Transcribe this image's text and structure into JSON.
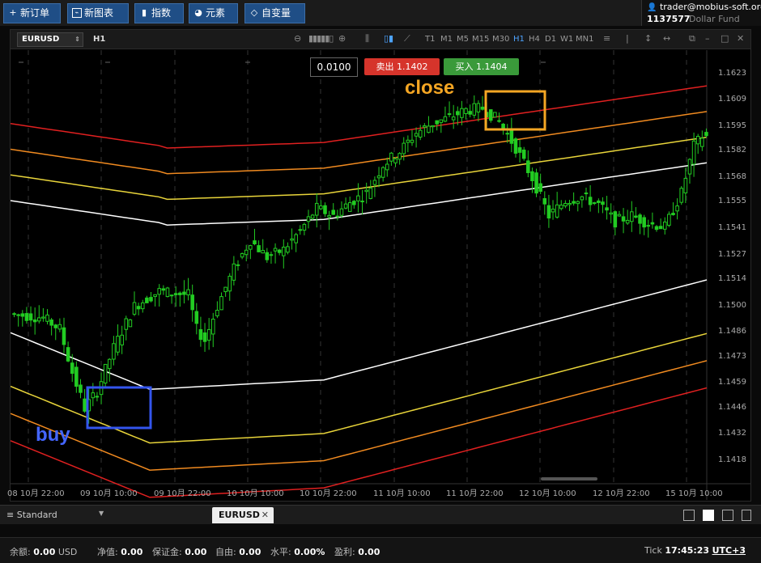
{
  "toolbar": {
    "buttons": [
      {
        "label": "新订单",
        "icon": "plus-icon"
      },
      {
        "label": "新图表",
        "icon": "chart-icon"
      },
      {
        "label": "指数",
        "icon": "indicator-icon"
      },
      {
        "label": "元素",
        "icon": "element-icon"
      },
      {
        "label": "自变量",
        "icon": "variable-icon"
      }
    ]
  },
  "account": {
    "email": "trader@mobius-soft.org",
    "number": "1137577",
    "name": "Dollar Fund"
  },
  "chart_header": {
    "symbol": "EURUSD",
    "timeframe": "H1",
    "timeframes": [
      "T1",
      "M1",
      "M5",
      "M15",
      "M30",
      "H1",
      "H4",
      "D1",
      "W1",
      "MN1"
    ],
    "active_timeframe": "H1"
  },
  "trade": {
    "lots": "0.0100",
    "sell_label": "卖出",
    "sell_price": "1.1402",
    "buy_label": "买入",
    "buy_price": "1.1404",
    "sell_color": "#d6342b",
    "buy_color": "#3a9a3a"
  },
  "annotations": {
    "close": "close",
    "buy": "buy"
  },
  "chart_data": {
    "type": "candlestick",
    "symbol": "EURUSD",
    "timeframe": "H1",
    "price_axis_ticks": [
      "1.1623",
      "1.1609",
      "1.1595",
      "1.1582",
      "1.1568",
      "1.1555",
      "1.1541",
      "1.1527",
      "1.1514",
      "1.1500",
      "1.1486",
      "1.1473",
      "1.1459",
      "1.1446",
      "1.1432",
      "1.1418"
    ],
    "time_axis_ticks": [
      "08 10月 22:00",
      "09 10月 10:00",
      "09 10月 22:00",
      "10 10月 10:00",
      "10 10月 22:00",
      "11 10月 10:00",
      "11 10月 22:00",
      "12 10月 10:00",
      "12 10月 22:00",
      "15 10月 10:00"
    ],
    "ylim": [
      1.1406,
      1.1634
    ],
    "bands": [
      {
        "name": "upper-2",
        "color": "#e02020"
      },
      {
        "name": "upper-1",
        "color": "#f08a20"
      },
      {
        "name": "upper-0",
        "color": "#e8d43a"
      },
      {
        "name": "middle",
        "color": "#ffffff"
      },
      {
        "name": "lower-0",
        "color": "#e8d43a"
      },
      {
        "name": "lower-1",
        "color": "#f08a20"
      },
      {
        "name": "lower-2",
        "color": "#e02020"
      }
    ],
    "candle_color": "#22cc22"
  },
  "tabs": {
    "profile": "Standard",
    "symbol_tab": "EURUSD"
  },
  "status": {
    "balance_label": "余额:",
    "balance": "0.00",
    "currency": "USD",
    "equity_label": "净值:",
    "equity": "0.00",
    "margin_label": "保证金:",
    "margin": "0.00",
    "free_label": "自由:",
    "free": "0.00",
    "level_label": "水平:",
    "level": "0.00%",
    "profit_label": "盈利:",
    "profit": "0.00",
    "tick_label": "Tick",
    "time": "17:45:23",
    "tz": "UTC+3"
  }
}
